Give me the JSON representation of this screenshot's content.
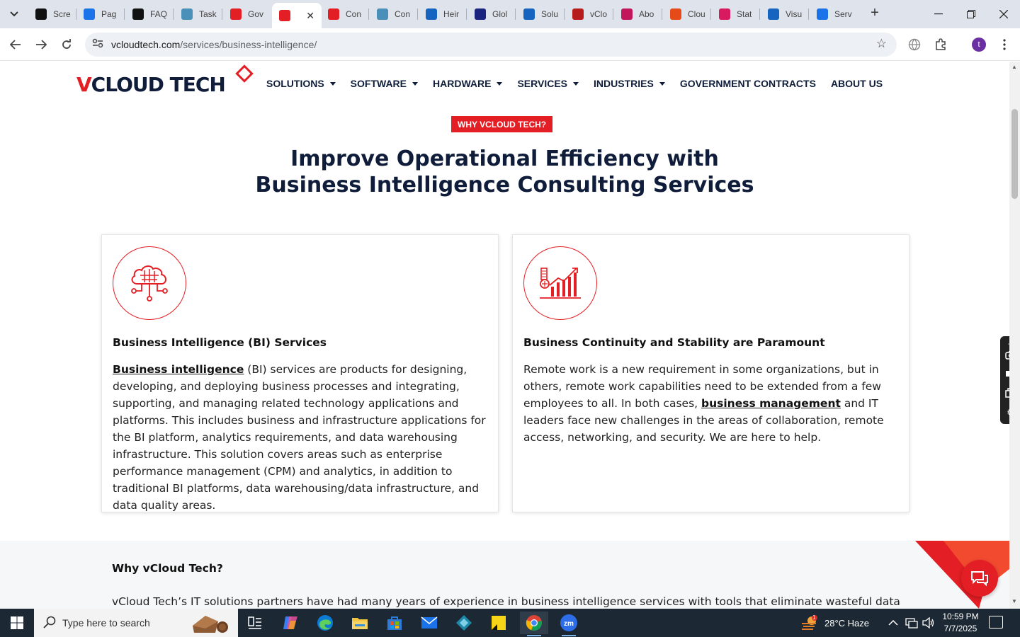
{
  "browser": {
    "tabs": [
      {
        "title": "Scre",
        "favicon": "screenpal-icon",
        "color": "#111"
      },
      {
        "title": "Pag",
        "favicon": "pagespeed-icon",
        "color": "#1a73e8"
      },
      {
        "title": "FAQ",
        "favicon": "openai-icon",
        "color": "#111"
      },
      {
        "title": "Task",
        "favicon": "clickup-icon",
        "color": "#4a90b8"
      },
      {
        "title": "Gov",
        "favicon": "vcloud-icon",
        "color": "#e31e24"
      },
      {
        "title": "",
        "favicon": "vcloud-icon",
        "color": "#e31e24",
        "active": true
      },
      {
        "title": "Con",
        "favicon": "vcloud-icon",
        "color": "#e31e24"
      },
      {
        "title": "Con",
        "favicon": "clickup-icon",
        "color": "#4a90b8"
      },
      {
        "title": "Heir",
        "favicon": "scales-icon",
        "color": "#1565c0"
      },
      {
        "title": "Glol",
        "favicon": "x-icon",
        "color": "#1a237e"
      },
      {
        "title": "Solu",
        "favicon": "check-icon",
        "color": "#1565c0"
      },
      {
        "title": "vClo",
        "favicon": "v-icon",
        "color": "#b71c1c"
      },
      {
        "title": "Abo",
        "favicon": "dots-icon",
        "color": "#c2185b"
      },
      {
        "title": "Clou",
        "favicon": "slash-icon",
        "color": "#e64a19"
      },
      {
        "title": "Stat",
        "favicon": "pen-icon",
        "color": "#d81b60"
      },
      {
        "title": "Visu",
        "favicon": "wave-icon",
        "color": "#1565c0"
      },
      {
        "title": "Serv",
        "favicon": "doc-icon",
        "color": "#1a73e8"
      }
    ],
    "url_domain": "vcloudtech.com",
    "url_path": "/services/business-intelligence/",
    "profile_initial": "t"
  },
  "site": {
    "logo_v": "V",
    "logo_rest": "CLOUD TECH",
    "nav": [
      {
        "label": "SOLUTIONS",
        "dropdown": true
      },
      {
        "label": "SOFTWARE",
        "dropdown": true
      },
      {
        "label": "HARDWARE",
        "dropdown": true
      },
      {
        "label": "SERVICES",
        "dropdown": true
      },
      {
        "label": "INDUSTRIES",
        "dropdown": true
      },
      {
        "label": "GOVERNMENT CONTRACTS",
        "dropdown": false
      },
      {
        "label": "ABOUT US",
        "dropdown": false
      }
    ],
    "badge": "WHY VCLOUD TECH?",
    "hero_line1": "Improve Operational Efficiency with",
    "hero_line2": "Business Intelligence Consulting Services",
    "cards": [
      {
        "icon": "brain-cloud-icon",
        "title": "Business Intelligence (BI) Services",
        "link": "Business intelligence",
        "body_before": "",
        "body_after": " (BI) services are products for designing, developing, and deploying business processes and integrating, supporting, and managing related technology applications and platforms. This includes business and infrastructure applications for the BI platform, analytics requirements, and data warehousing infrastructure. This solution covers areas such as enterprise performance management (CPM) and analytics, in addition to traditional BI platforms, data warehousing/data infrastructure, and data quality areas."
      },
      {
        "icon": "growth-chart-icon",
        "title": "Business Continuity and Stability are Paramount",
        "link": "business management",
        "body_before": "Remote work is a new requirement in some organizations, but in others, remote work capabilities need to be extended from a few employees to all. In both cases, ",
        "body_after": " and IT leaders face new challenges in the areas of collaboration, remote access, networking, and security. We are here to help."
      }
    ],
    "why_title": "Why vCloud Tech?",
    "why_body": "vCloud Tech’s IT solutions partners have had many years of experience in business intelligence services with tools that eliminate wasteful data",
    "brand_red": "#e31e24",
    "brand_navy": "#0f1d3a"
  },
  "taskbar": {
    "search_placeholder": "Type here to search",
    "weather": "28°C  Haze",
    "time": "10:59 PM",
    "date": "7/7/2025",
    "weather_badge": "1"
  }
}
